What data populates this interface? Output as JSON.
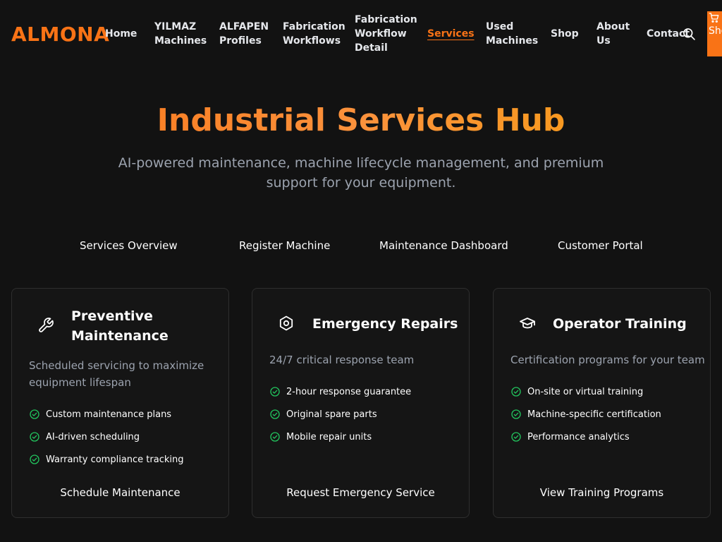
{
  "brand": {
    "name": "ALMONA",
    "accent": "#f97316"
  },
  "nav": {
    "items": [
      {
        "id": "home",
        "label": "Home"
      },
      {
        "id": "yilmaz",
        "label": "YILMAZ Machines"
      },
      {
        "id": "alfapen",
        "label": "ALFAPEN Profiles"
      },
      {
        "id": "fabrication-workflows",
        "label": "Fabrication Workflows"
      },
      {
        "id": "fabrication-workflow-detail",
        "label": "Fabrication Workflow Detail"
      },
      {
        "id": "services",
        "label": "Services",
        "active": true
      },
      {
        "id": "used-machines",
        "label": "Used Machines"
      },
      {
        "id": "shop",
        "label": "Shop"
      },
      {
        "id": "about",
        "label": "About Us"
      },
      {
        "id": "contact",
        "label": "Contact"
      }
    ],
    "search_icon": "search-icon",
    "shop_button": {
      "icon": "cart-icon",
      "label": "Shop Now"
    }
  },
  "hero": {
    "title": "Industrial Services Hub",
    "subtitle": "AI-powered maintenance, machine lifecycle management, and premium support for your equipment."
  },
  "tabs": [
    {
      "label": "Services Overview"
    },
    {
      "label": "Register Machine"
    },
    {
      "label": "Maintenance Dashboard"
    },
    {
      "label": "Customer Portal"
    }
  ],
  "cards": [
    {
      "icon": "wrench-icon",
      "title": "Preventive Maintenance",
      "description": "Scheduled servicing to maximize equipment lifespan",
      "features": [
        "Custom maintenance plans",
        "AI-driven scheduling",
        "Warranty compliance tracking"
      ],
      "cta": "Schedule Maintenance"
    },
    {
      "icon": "hexagon-icon",
      "title": "Emergency Repairs",
      "description": "24/7 critical response team",
      "features": [
        "2-hour response guarantee",
        "Original spare parts",
        "Mobile repair units"
      ],
      "cta": "Request Emergency Service"
    },
    {
      "icon": "graduation-cap-icon",
      "title": "Operator Training",
      "description": "Certification programs for your team",
      "features": [
        "On-site or virtual training",
        "Machine-specific certification",
        "Performance analytics"
      ],
      "cta": "View Training Programs"
    }
  ],
  "colors": {
    "check": "#22c55e",
    "muted_text": "#9ca3af",
    "card_border": "#2e2e2e"
  }
}
